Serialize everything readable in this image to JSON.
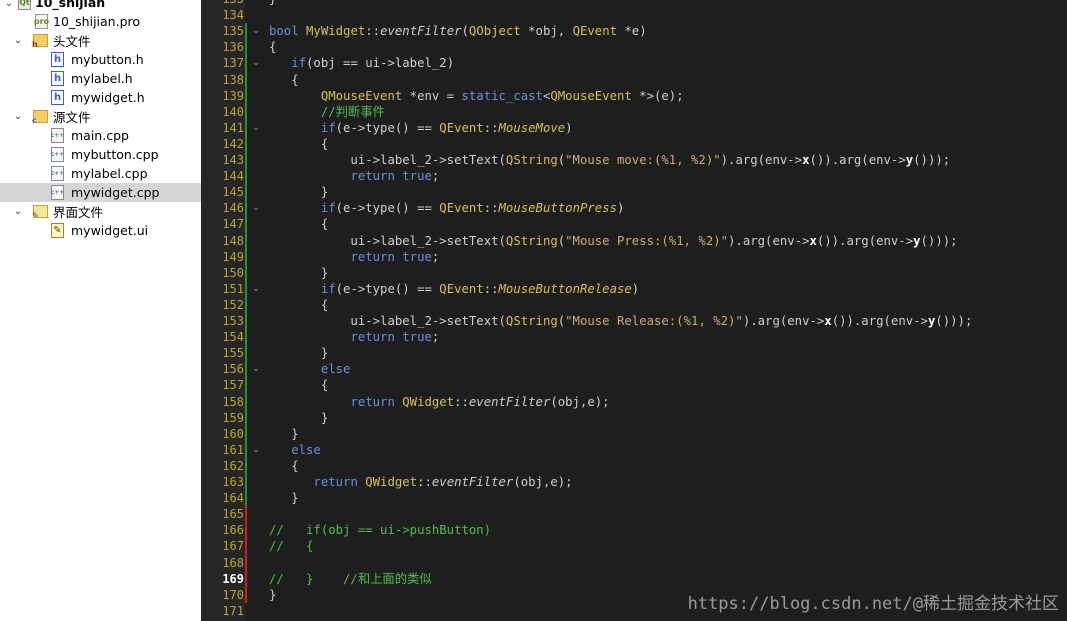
{
  "project_tree": {
    "project": {
      "label": "10_shijian",
      "icon": "qt-project-icon"
    },
    "pro_file": {
      "label": "10_shijian.pro",
      "icon": "pro-file-icon"
    },
    "header_folder": {
      "label": "头文件",
      "icon": "header-folder-icon",
      "files": [
        "mybutton.h",
        "mylabel.h",
        "mywidget.h"
      ]
    },
    "source_folder": {
      "label": "源文件",
      "icon": "source-folder-icon",
      "files": [
        "main.cpp",
        "mybutton.cpp",
        "mylabel.cpp",
        "mywidget.cpp"
      ],
      "selected": "mywidget.cpp"
    },
    "form_folder": {
      "label": "界面文件",
      "icon": "form-folder-icon",
      "files": [
        "mywidget.ui"
      ]
    }
  },
  "editor": {
    "first_line": 133,
    "current_line": 169,
    "line_numbers": [
      "133",
      "134",
      "135",
      "136",
      "137",
      "138",
      "139",
      "140",
      "141",
      "142",
      "143",
      "144",
      "145",
      "146",
      "147",
      "148",
      "149",
      "150",
      "151",
      "152",
      "153",
      "154",
      "155",
      "156",
      "157",
      "158",
      "159",
      "160",
      "161",
      "162",
      "163",
      "164",
      "165",
      "166",
      "167",
      "168",
      "169",
      "170",
      "171"
    ],
    "fold_markers_at": [
      135,
      137,
      141,
      146,
      151,
      156,
      161
    ],
    "code_lines": [
      [
        [
          "sym",
          "}"
        ]
      ],
      [],
      [
        [
          "kw",
          "bool"
        ],
        [
          "sym",
          " "
        ],
        [
          "ty",
          "MyWidget"
        ],
        [
          "sym",
          "::"
        ],
        [
          "it",
          "eventFilter"
        ],
        [
          "sym",
          "("
        ],
        [
          "ty",
          "QObject"
        ],
        [
          "sym",
          " *obj, "
        ],
        [
          "ty",
          "QEvent"
        ],
        [
          "sym",
          " *e)"
        ]
      ],
      [
        [
          "sym",
          "{"
        ]
      ],
      [
        [
          "sym",
          "   "
        ],
        [
          "kw",
          "if"
        ],
        [
          "sym",
          "(obj == ui->label_2)"
        ]
      ],
      [
        [
          "sym",
          "   {"
        ]
      ],
      [
        [
          "sym",
          "       "
        ],
        [
          "ty",
          "QMouseEvent"
        ],
        [
          "sym",
          " *env = "
        ],
        [
          "kw",
          "static_cast"
        ],
        [
          "sym",
          "<"
        ],
        [
          "ty",
          "QMouseEvent"
        ],
        [
          "sym",
          " *>(e);"
        ]
      ],
      [
        [
          "sym",
          "       "
        ],
        [
          "cm",
          "//判断事件"
        ]
      ],
      [
        [
          "sym",
          "       "
        ],
        [
          "kw",
          "if"
        ],
        [
          "sym",
          "(e->type() == "
        ],
        [
          "ty",
          "QEvent"
        ],
        [
          "sym",
          "::"
        ],
        [
          "en",
          "MouseMove"
        ],
        [
          "sym",
          ")"
        ]
      ],
      [
        [
          "sym",
          "       {"
        ]
      ],
      [
        [
          "sym",
          "           ui->label_2->setText("
        ],
        [
          "ty",
          "QString"
        ],
        [
          "sym",
          "("
        ],
        [
          "st",
          "\"Mouse move:(%1, %2)\""
        ],
        [
          "sym",
          ").arg(env->"
        ],
        [
          "bo",
          "x"
        ],
        [
          "sym",
          "()).arg(env->"
        ],
        [
          "bo",
          "y"
        ],
        [
          "sym",
          "()));"
        ]
      ],
      [
        [
          "sym",
          "           "
        ],
        [
          "kw",
          "return true"
        ],
        [
          "sym",
          ";"
        ]
      ],
      [
        [
          "sym",
          "       }"
        ]
      ],
      [
        [
          "sym",
          "       "
        ],
        [
          "kw",
          "if"
        ],
        [
          "sym",
          "(e->type() == "
        ],
        [
          "ty",
          "QEvent"
        ],
        [
          "sym",
          "::"
        ],
        [
          "en",
          "MouseButtonPress"
        ],
        [
          "sym",
          ")"
        ]
      ],
      [
        [
          "sym",
          "       {"
        ]
      ],
      [
        [
          "sym",
          "           ui->label_2->setText("
        ],
        [
          "ty",
          "QString"
        ],
        [
          "sym",
          "("
        ],
        [
          "st",
          "\"Mouse Press:(%1, %2)\""
        ],
        [
          "sym",
          ").arg(env->"
        ],
        [
          "bo",
          "x"
        ],
        [
          "sym",
          "()).arg(env->"
        ],
        [
          "bo",
          "y"
        ],
        [
          "sym",
          "()));"
        ]
      ],
      [
        [
          "sym",
          "           "
        ],
        [
          "kw",
          "return true"
        ],
        [
          "sym",
          ";"
        ]
      ],
      [
        [
          "sym",
          "       }"
        ]
      ],
      [
        [
          "sym",
          "       "
        ],
        [
          "kw",
          "if"
        ],
        [
          "sym",
          "(e->type() == "
        ],
        [
          "ty",
          "QEvent"
        ],
        [
          "sym",
          "::"
        ],
        [
          "en",
          "MouseButtonRelease"
        ],
        [
          "sym",
          ")"
        ]
      ],
      [
        [
          "sym",
          "       {"
        ]
      ],
      [
        [
          "sym",
          "           ui->label_2->setText("
        ],
        [
          "ty",
          "QString"
        ],
        [
          "sym",
          "("
        ],
        [
          "st",
          "\"Mouse Release:(%1, %2)\""
        ],
        [
          "sym",
          ").arg(env->"
        ],
        [
          "bo",
          "x"
        ],
        [
          "sym",
          "()).arg(env->"
        ],
        [
          "bo",
          "y"
        ],
        [
          "sym",
          "()));"
        ]
      ],
      [
        [
          "sym",
          "           "
        ],
        [
          "kw",
          "return true"
        ],
        [
          "sym",
          ";"
        ]
      ],
      [
        [
          "sym",
          "       }"
        ]
      ],
      [
        [
          "sym",
          "       "
        ],
        [
          "kw",
          "else"
        ]
      ],
      [
        [
          "sym",
          "       {"
        ]
      ],
      [
        [
          "sym",
          "           "
        ],
        [
          "kw",
          "return"
        ],
        [
          "sym",
          " "
        ],
        [
          "ty",
          "QWidget"
        ],
        [
          "sym",
          "::"
        ],
        [
          "it",
          "eventFilter"
        ],
        [
          "sym",
          "(obj,e);"
        ]
      ],
      [
        [
          "sym",
          "       }"
        ]
      ],
      [
        [
          "sym",
          "   }"
        ]
      ],
      [
        [
          "sym",
          "   "
        ],
        [
          "kw",
          "else"
        ]
      ],
      [
        [
          "sym",
          "   {"
        ]
      ],
      [
        [
          "sym",
          "      "
        ],
        [
          "kw",
          "return"
        ],
        [
          "sym",
          " "
        ],
        [
          "ty",
          "QWidget"
        ],
        [
          "sym",
          "::"
        ],
        [
          "it",
          "eventFilter"
        ],
        [
          "sym",
          "(obj,e);"
        ]
      ],
      [
        [
          "sym",
          "   }"
        ]
      ],
      [],
      [
        [
          "cm",
          "//   if(obj == ui->pushButton)"
        ]
      ],
      [
        [
          "cm",
          "//   {"
        ]
      ],
      [],
      [
        [
          "cm",
          "//   }    //和上面的类似"
        ]
      ],
      [
        [
          "sym",
          "}"
        ]
      ],
      []
    ]
  },
  "watermark": "https://blog.csdn.net/@稀土掘金技术社区",
  "colors": {
    "editor_bg": "#1e1e1e",
    "keyword": "#6f8fdc",
    "type": "#d4c24a",
    "comment": "#4fbf4f",
    "string": "#c9ad6e",
    "line_number": "#bda62e",
    "selection": "#d6d6d6"
  }
}
